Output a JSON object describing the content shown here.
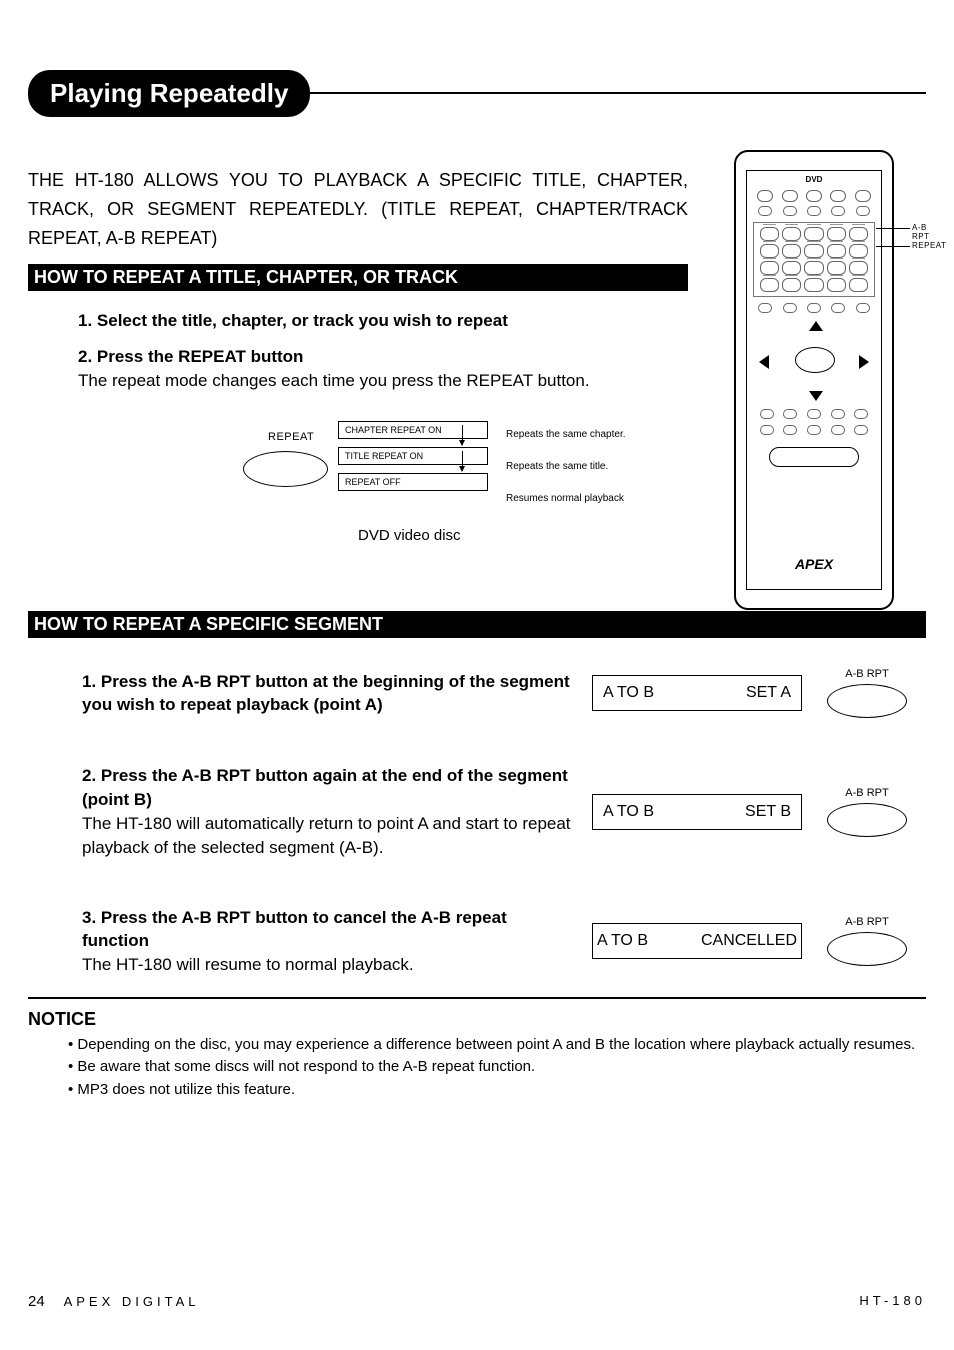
{
  "title": "Playing Repeatedly",
  "intro": "THE HT-180 ALLOWS YOU TO PLAYBACK A SPECIFIC TITLE, CHAPTER, TRACK, OR SEGMENT REPEATEDLY. (TITLE REPEAT, CHAPTER/TRACK REPEAT, A-B REPEAT)",
  "section1": {
    "heading": "HOW TO REPEAT A TITLE, CHAPTER, OR TRACK",
    "step1": "1. Select the title, chapter, or track you wish to repeat",
    "step2": "2. Press the REPEAT button",
    "step2_body": "The repeat mode changes each time you press the REPEAT button.",
    "btn_label": "REPEAT",
    "states": [
      {
        "box": "CHAPTER REPEAT ON",
        "desc": "Repeats the same chapter."
      },
      {
        "box": "TITLE REPEAT ON",
        "desc": "Repeats the same title."
      },
      {
        "box": "REPEAT OFF",
        "desc": "Resumes normal playback"
      }
    ],
    "caption": "DVD video disc"
  },
  "remote": {
    "label_abrpt": "A-B RPT",
    "label_repeat": "REPEAT",
    "logo": "APEX"
  },
  "section2": {
    "heading": "HOW TO REPEAT A SPECIFIC SEGMENT",
    "btn_label": "A-B RPT",
    "steps": [
      {
        "bold": "1. Press the A-B RPT button at the beginning of the segment you wish to repeat playback (point A)",
        "body": "",
        "display_l": "A  TO  B",
        "display_r": "SET A"
      },
      {
        "bold": "2. Press the A-B RPT button again at the end of the segment (point B)",
        "body": "The HT-180 will automatically return to point A and start to repeat playback of the selected segment (A-B).",
        "display_l": "A  TO  B",
        "display_r": "SET B"
      },
      {
        "bold": "3. Press the A-B RPT button to cancel the A-B repeat function",
        "body": "The HT-180 will resume to normal playback.",
        "display_l": "A TO B",
        "display_r": "CANCELLED"
      }
    ]
  },
  "notice": {
    "heading": "NOTICE",
    "items": [
      "Depending on the disc, you may experience a difference between point A and B the location where playback actually resumes.",
      "Be aware that some discs will not respond to the A-B repeat function.",
      "MP3 does not utilize this feature."
    ]
  },
  "footer": {
    "page": "24",
    "brand": "APEX DIGITAL",
    "model": "HT-180"
  }
}
